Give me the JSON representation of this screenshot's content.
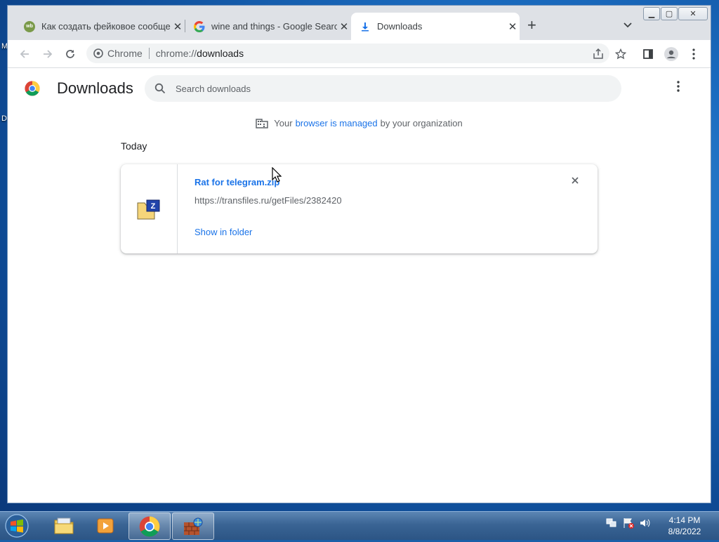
{
  "desktop": {
    "edge_glyphs": [
      "M",
      "D"
    ]
  },
  "tabs": [
    {
      "title": "Как создать фейковое сообщени",
      "favicon": "wb-icon"
    },
    {
      "title": "wine and things - Google Search",
      "favicon": "google-icon"
    },
    {
      "title": "Downloads",
      "favicon": "download-icon",
      "active": true
    }
  ],
  "omnibox": {
    "chip": "Chrome",
    "scheme": "chrome://",
    "host": "downloads"
  },
  "page": {
    "title": "Downloads",
    "search_placeholder": "Search downloads",
    "managed": {
      "before": "Your",
      "link": "browser is managed",
      "after": "by your organization"
    },
    "date_heading": "Today"
  },
  "download": {
    "file_name": "Rat for telegram.zip",
    "url": "https://transfiles.ru/getFiles/2382420",
    "show_in_folder": "Show in folder"
  },
  "taskbar": {
    "time": "4:14 PM",
    "date": "8/8/2022"
  },
  "colors": {
    "accent": "#1a73e8",
    "tab_strip": "#dee1e6"
  }
}
